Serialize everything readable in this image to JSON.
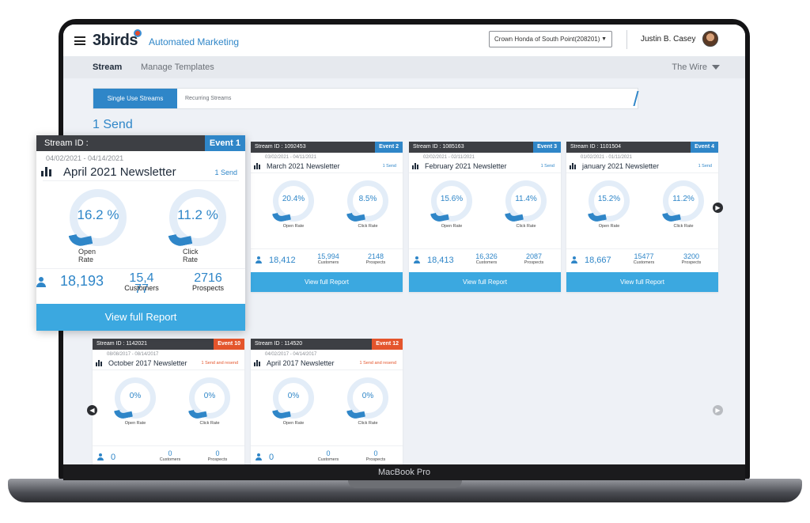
{
  "device_label": "MacBook Pro",
  "header": {
    "logo": "3birds",
    "app_title": "Automated Marketing",
    "dealer": "Crown Honda of South Point(208201)",
    "user": "Justin B. Casey"
  },
  "subnav": {
    "stream": "Stream",
    "manage": "Manage Templates",
    "wire": "The Wire"
  },
  "toggle": {
    "active": "Single Use Streams",
    "inactive": "Recurring Streams"
  },
  "section_title": "1 Send",
  "labels": {
    "open_rate": "Open Rate",
    "click_rate": "Click Rate",
    "customers": "Customers",
    "prospects": "Prospects",
    "view_report": "View full Report"
  },
  "zoom": {
    "stream_id": "Stream ID :",
    "event": "Event 1",
    "dates": "04/02/2021 - 04/14/2021",
    "name": "April 2021 Newsletter",
    "send": "1 Send",
    "open_rate": "16.2 %",
    "click_rate": "11.2 %",
    "open_label": "Open Rate",
    "click_label": "Click Rate",
    "total": "18,193",
    "customers": "15,477",
    "prospects": "2716",
    "customers_label": "Customers",
    "prospects_label": "Prospects",
    "button": "View full Report"
  },
  "cards": [
    {
      "stream_id": "Stream ID : 1092453",
      "event": "Event 2",
      "dates": "03/02/2021 - 04/11/2021",
      "name": "March 2021 Newsletter",
      "send": "1 Send",
      "open_rate": "20.4%",
      "click_rate": "8.5%",
      "total": "18,412",
      "customers": "15,994",
      "prospects": "2148"
    },
    {
      "stream_id": "Stream ID : 1085163",
      "event": "Event 3",
      "dates": "02/02/2021 - 02/11/2021",
      "name": "February 2021 Newsletter",
      "send": "1 Send",
      "open_rate": "15.6%",
      "click_rate": "11.4%",
      "total": "18,413",
      "customers": "16,326",
      "prospects": "2087"
    },
    {
      "stream_id": "Stream ID : 1101504",
      "event": "Event 4",
      "dates": "01/02/2021 - 01/11/2021",
      "name": "january 2021 Newsletter",
      "send": "1 Send",
      "open_rate": "15.2%",
      "click_rate": "11.2%",
      "total": "18,667",
      "customers": "15477",
      "prospects": "3200"
    },
    {
      "stream_id": "Stream ID : 1142021",
      "event": "Event 10",
      "dates": "08/08/2017 - 08/14/2017",
      "name": "October 2017 Newsletter",
      "send": "1 Send and resend",
      "open_rate": "0%",
      "click_rate": "0%",
      "total": "0",
      "customers": "0",
      "prospects": "0"
    },
    {
      "stream_id": "Stream ID : 114520",
      "event": "Event 12",
      "dates": "04/02/2017 - 04/14/2017",
      "name": "April 2017 Newsletter",
      "send": "1 Send and resend",
      "open_rate": "0%",
      "click_rate": "0%",
      "total": "0",
      "customers": "0",
      "prospects": "0"
    }
  ],
  "colors": {
    "primary": "#2f86c8",
    "button": "#3ba8e0",
    "alert": "#e4552c",
    "header_dark": "#3d3f44"
  },
  "icons": {
    "menu": "hamburger-icon",
    "bars": "bar-chart-icon",
    "person": "person-icon",
    "next": "chevron-right-icon",
    "prev": "chevron-left-icon"
  }
}
